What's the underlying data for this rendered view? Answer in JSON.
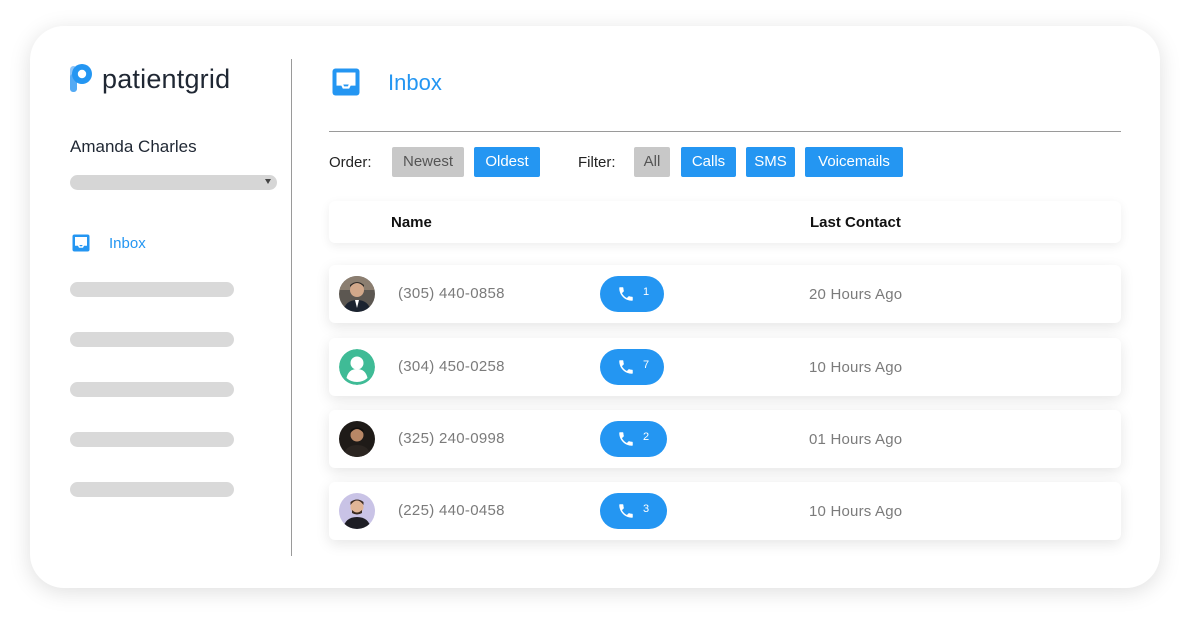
{
  "brand": {
    "name": "patientgrid",
    "accent": "#2496f2",
    "logo_icon": "patientgrid-logo-icon"
  },
  "sidebar": {
    "user_name": "Amanda Charles",
    "nav": [
      {
        "label": "Inbox",
        "icon": "inbox-icon",
        "active": true
      }
    ]
  },
  "main": {
    "title": "Inbox",
    "title_icon": "inbox-icon",
    "order": {
      "label": "Order:",
      "options": [
        "Newest",
        "Oldest"
      ],
      "selected": "Newest"
    },
    "filter": {
      "label": "Filter:",
      "options": [
        "All",
        "Calls",
        "SMS",
        "Voicemails"
      ],
      "selected": "All"
    },
    "table": {
      "headers": {
        "name": "Name",
        "last_contact": "Last Contact"
      },
      "rows": [
        {
          "phone": "(305) 440-0858",
          "calls": "1",
          "last_contact": "20 Hours Ago",
          "avatar": "photo-man-suit"
        },
        {
          "phone": "(304) 450-0258",
          "calls": "7",
          "last_contact": "10 Hours Ago",
          "avatar": "default-user-icon"
        },
        {
          "phone": "(325) 240-0998",
          "calls": "2",
          "last_contact": "01 Hours Ago",
          "avatar": "photo-man-dark"
        },
        {
          "phone": "(225) 440-0458",
          "calls": "3",
          "last_contact": "10 Hours Ago",
          "avatar": "photo-man-beard"
        }
      ]
    }
  }
}
